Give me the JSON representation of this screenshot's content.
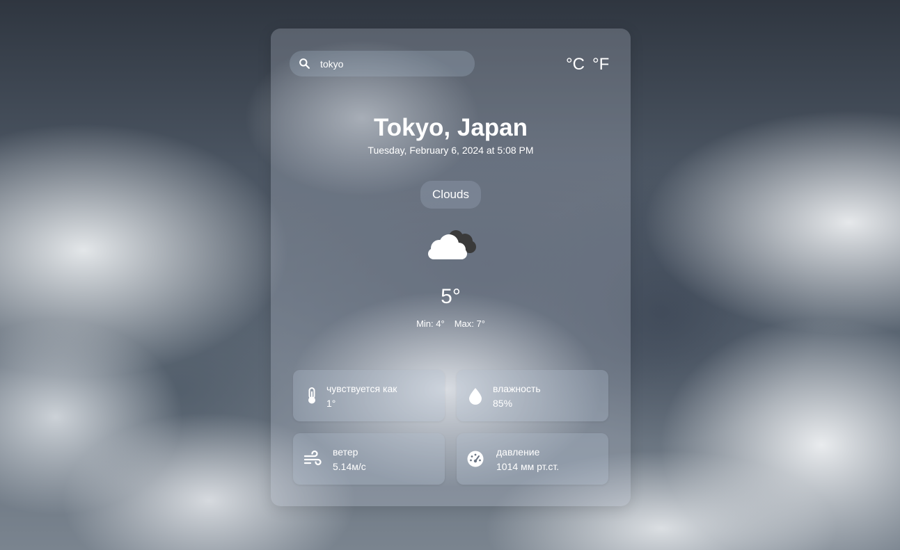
{
  "search": {
    "value": "tokyo",
    "icon": "search-icon"
  },
  "units": {
    "celsius_label": "°C",
    "fahrenheit_label": "°F"
  },
  "location": {
    "city": "Tokyo, Japan",
    "datetime": "Tuesday, February 6, 2024 at 5:08 PM"
  },
  "weather": {
    "condition": "Clouds",
    "icon": "cloud-icon",
    "temperature": "5°",
    "min": "Min: 4°",
    "max": "Max: 7°"
  },
  "stats": [
    {
      "icon": "thermometer-icon",
      "label": "чувствуется как",
      "value": "1°"
    },
    {
      "icon": "droplet-icon",
      "label": "влажность",
      "value": "85%"
    },
    {
      "icon": "wind-icon",
      "label": "ветер",
      "value": "5.14м/с"
    },
    {
      "icon": "gauge-icon",
      "label": "давление",
      "value": "1014 мм рт.ст."
    }
  ],
  "colors": {
    "text": "#ffffff",
    "card": "rgba(185,195,210,0.28)"
  }
}
